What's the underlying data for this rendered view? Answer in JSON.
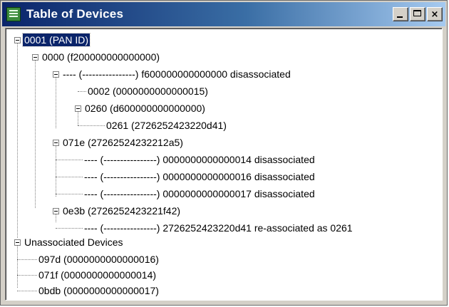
{
  "window": {
    "title": "Table of Devices",
    "title_icon": "table-icon",
    "buttons": {
      "minimize": "minimize",
      "maximize": "maximize",
      "close": "×"
    },
    "titlebar_gradient": [
      "#0a246a",
      "#a6caf0"
    ],
    "selection_color": "#0a246a"
  },
  "tree": {
    "pan": {
      "label": "0001 (PAN ID)",
      "selected": true
    },
    "n0000": {
      "label": "0000 (f200000000000000)"
    },
    "dash1": {
      "label": "---- (----------------) f600000000000000 disassociated"
    },
    "n0002": {
      "label": "0002 (0000000000000015)"
    },
    "n0260": {
      "label": "0260 (d600000000000000)"
    },
    "n0261": {
      "label": "0261 (2726252423220d41)"
    },
    "n071e": {
      "label": "071e (27262524232212a5)"
    },
    "dash2": {
      "label": "---- (----------------) 0000000000000014 disassociated"
    },
    "dash3": {
      "label": "---- (----------------) 0000000000000016 disassociated"
    },
    "dash4": {
      "label": "---- (----------------) 0000000000000017 disassociated"
    },
    "n0e3b": {
      "label": "0e3b (2726252423221f42)"
    },
    "dash5": {
      "label": "---- (----------------) 2726252423220d41 re-associated as 0261"
    },
    "unassoc": {
      "label": "Unassociated Devices"
    },
    "n097d": {
      "label": "097d (0000000000000016)"
    },
    "n071f": {
      "label": "071f (0000000000000014)"
    },
    "n0bdb": {
      "label": "0bdb (0000000000000017)"
    }
  }
}
